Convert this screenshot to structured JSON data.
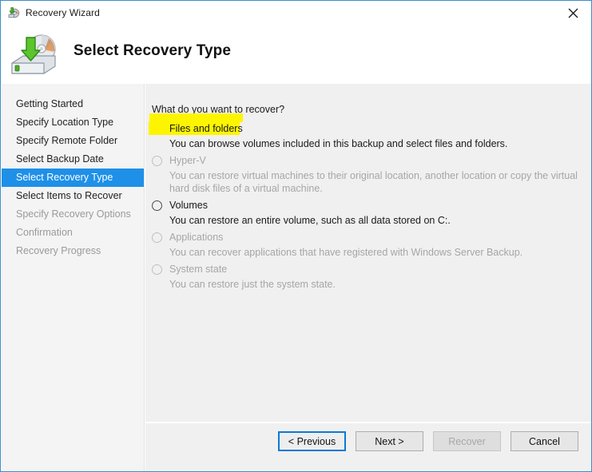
{
  "window": {
    "title": "Recovery Wizard",
    "title_icon": "recovery-disk-icon",
    "close_icon": "close-icon"
  },
  "header": {
    "title": "Select Recovery Type",
    "icon": "recovery-disk-arrow-icon"
  },
  "sidebar": {
    "items": [
      {
        "label": "Getting Started",
        "state": "complete"
      },
      {
        "label": "Specify Location Type",
        "state": "complete"
      },
      {
        "label": "Specify Remote Folder",
        "state": "complete"
      },
      {
        "label": "Select Backup Date",
        "state": "complete"
      },
      {
        "label": "Select Recovery Type",
        "state": "active"
      },
      {
        "label": "Select Items to Recover",
        "state": "complete"
      },
      {
        "label": "Specify Recovery Options",
        "state": "disabled"
      },
      {
        "label": "Confirmation",
        "state": "disabled"
      },
      {
        "label": "Recovery Progress",
        "state": "disabled"
      }
    ]
  },
  "main": {
    "question": "What do you want to recover?",
    "options": [
      {
        "label": "Files and folders",
        "description": "You can browse volumes included in this backup and select files and folders.",
        "selected": true,
        "enabled": true,
        "highlighted": true
      },
      {
        "label": "Hyper-V",
        "description": "You can restore virtual machines to their original location, another location or copy the virtual hard disk files of a virtual machine.",
        "selected": false,
        "enabled": false,
        "highlighted": false
      },
      {
        "label": "Volumes",
        "description": "You can restore an entire volume, such as all data stored on C:.",
        "selected": false,
        "enabled": true,
        "highlighted": false
      },
      {
        "label": "Applications",
        "description": "You can recover applications that have registered with Windows Server Backup.",
        "selected": false,
        "enabled": false,
        "highlighted": false
      },
      {
        "label": "System state",
        "description": "You can restore just the system state.",
        "selected": false,
        "enabled": false,
        "highlighted": false
      }
    ]
  },
  "footer": {
    "buttons": [
      {
        "label": "< Previous",
        "state": "focused"
      },
      {
        "label": "Next >",
        "state": "normal"
      },
      {
        "label": "Recover",
        "state": "disabled"
      },
      {
        "label": "Cancel",
        "state": "normal"
      }
    ]
  },
  "colors": {
    "accent": "#1e90e8",
    "window_border": "#3d8ec9",
    "highlight_marker": "#fdf500",
    "panel_bg": "#f0f0f0"
  }
}
